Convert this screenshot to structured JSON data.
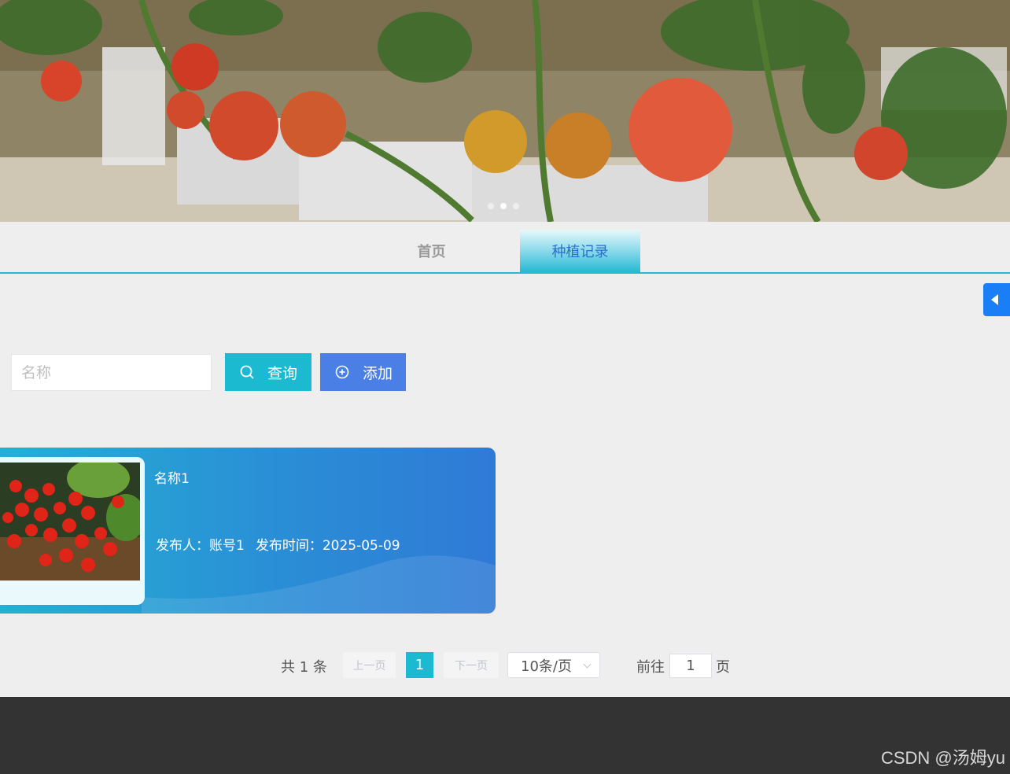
{
  "banner": {
    "image": "tomato-greenhouse-photo",
    "slide_count": 3,
    "active_slide": 1
  },
  "nav": {
    "items": [
      {
        "label": "首页"
      },
      {
        "label": "种植记录"
      }
    ],
    "active": "种植记录"
  },
  "side_toggle": {
    "icon": "caret-left-icon"
  },
  "search": {
    "placeholder": "名称",
    "query_label": "查询",
    "add_label": "添加",
    "query_icon": "search-icon",
    "add_icon": "plus-circle-icon"
  },
  "records": [
    {
      "title": "名称1",
      "image": "cherry-tomatoes-photo",
      "publisher": "发布人：账号1",
      "publish_time": "发布时间：2025-05-09"
    }
  ],
  "pagination": {
    "total_text": "共 1 条",
    "prev_label": "上一页",
    "next_label": "下一页",
    "current_page": "1",
    "page_size": "10条/页",
    "goto_label": "前往",
    "goto_value": "1",
    "page_suffix": "页"
  },
  "watermark": "CSDN @汤姆yu",
  "colors": {
    "accent": "#1bbad0",
    "add_button": "#4a7fe6",
    "card": "#2a8fd6",
    "footer": "#333333",
    "side_toggle": "#1a7ef7"
  }
}
